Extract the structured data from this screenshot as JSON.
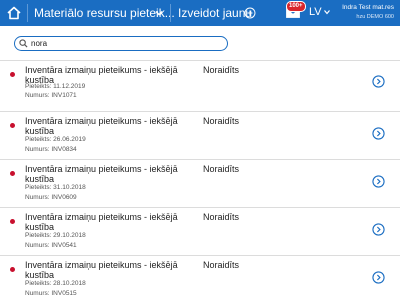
{
  "header": {
    "title": "Materiālo resursu pieteik...",
    "create_label": "Izveidot jaunu",
    "mail_badge": "100+",
    "language": "LV",
    "user_name": "Indra Test mat.res",
    "user_db": "hzu DEMO 600",
    "accent_color": "#1a6dc2",
    "icons": [
      "home-icon",
      "chevron-down-icon",
      "plus-circle-icon",
      "mail-icon",
      "chevron-down-icon"
    ]
  },
  "search": {
    "value": "nora",
    "icon": "search-icon"
  },
  "items": [
    {
      "title": "Inventāra izmaiņu pieteikums - iekšējā kustība",
      "status": "Noraidīts",
      "date": "Pieteikts: 11.12.2019",
      "number": "Numurs: INV1071"
    },
    {
      "title": "Inventāra izmaiņu pieteikums - iekšējā kustība",
      "status": "Noraidīts",
      "date": "Pieteikts: 26.06.2019",
      "number": "Numurs: INV0834"
    },
    {
      "title": "Inventāra izmaiņu pieteikums - iekšējā kustība",
      "status": "Noraidīts",
      "date": "Pieteikts: 31.10.2018",
      "number": "Numurs: INV0609"
    },
    {
      "title": "Inventāra izmaiņu pieteikums - iekšējā kustība",
      "status": "Noraidīts",
      "date": "Pieteikts: 29.10.2018",
      "number": "Numurs: INV0541"
    },
    {
      "title": "Inventāra izmaiņu pieteikums - iekšējā kustība",
      "status": "Noraidīts",
      "date": "Pieteikts: 28.10.2018",
      "number": "Numurs: INV0515"
    }
  ],
  "status_dot_color": "#c8102e"
}
